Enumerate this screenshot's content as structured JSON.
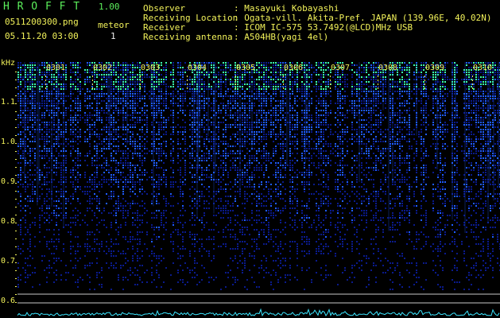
{
  "app": {
    "name": "H R O F F T",
    "version": "1.00",
    "filename": "0511200300.png",
    "datetime": "05.11.20 03:00",
    "meteor_label": "meteor",
    "meteor_count": "1"
  },
  "info": {
    "rows": [
      {
        "key": "Observer",
        "value": ": Masayuki Kobayashi"
      },
      {
        "key": "Receiving Location",
        "value": ": Ogata-vill. Akita-Pref. JAPAN (139.96E, 40.02N)"
      },
      {
        "key": "Receiver",
        "value": ": ICOM IC-575 53.7492(@LCD)MHz USB"
      },
      {
        "key": "Receiving antenna",
        "value": ": A504HB(yagi 4el)"
      }
    ]
  },
  "spectrogram": {
    "yunit": "kHz",
    "y_ticks": [
      "1.1",
      "1.0",
      "0.9",
      "0.8",
      "0.7",
      "0.6"
    ],
    "x_ticks": [
      "0301",
      "0302",
      "0303",
      "0304",
      "0305",
      "0306",
      "0307",
      "0308",
      "0309",
      "0310"
    ],
    "colors": {
      "background": "#000000",
      "text": "#f2f25a",
      "signal_low": "#0a1a8c",
      "signal_mid": "#1f5cff",
      "signal_high": "#3cffb0",
      "baseline": "#3ce6ff",
      "guide_line": "#c8c8c8"
    }
  }
}
